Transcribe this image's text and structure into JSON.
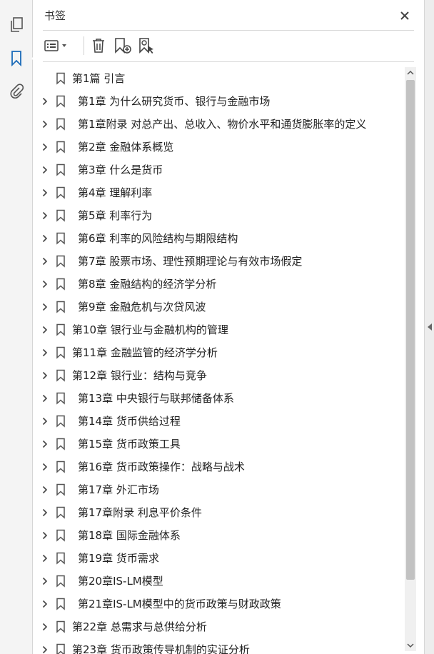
{
  "panel": {
    "title": "书签"
  },
  "icons": {
    "rail": [
      "pages-icon",
      "bookmark-icon",
      "attachment-icon"
    ],
    "toolbar": [
      "options-list-icon",
      "delete-icon",
      "new-bookmark-icon",
      "bookmark-search-icon"
    ]
  },
  "accent_color": "#1a6ab8",
  "bookmarks": [
    {
      "label": "第1篇  引言",
      "expandable": false,
      "indent": false
    },
    {
      "label": "第1章  为什么研究货币、银行与金融市场",
      "expandable": true,
      "indent": true
    },
    {
      "label": "第1章附录  对总产出、总收入、物价水平和通货膨胀率的定义",
      "expandable": true,
      "indent": true
    },
    {
      "label": "第2章  金融体系概览",
      "expandable": true,
      "indent": true
    },
    {
      "label": "第3章  什么是货币",
      "expandable": true,
      "indent": true
    },
    {
      "label": "第4章  理解利率",
      "expandable": true,
      "indent": true
    },
    {
      "label": "第5章  利率行为",
      "expandable": true,
      "indent": true
    },
    {
      "label": "第6章  利率的风险结构与期限结构",
      "expandable": true,
      "indent": true
    },
    {
      "label": "第7章  股票市场、理性预期理论与有效市场假定",
      "expandable": true,
      "indent": true
    },
    {
      "label": "第8章  金融结构的经济学分析",
      "expandable": true,
      "indent": true
    },
    {
      "label": "第9章  金融危机与次贷风波",
      "expandable": true,
      "indent": true
    },
    {
      "label": "第10章  银行业与金融机构的管理",
      "expandable": true,
      "indent": false
    },
    {
      "label": "第11章  金融监管的经济学分析",
      "expandable": true,
      "indent": false
    },
    {
      "label": "第12章  银行业：结构与竞争",
      "expandable": true,
      "indent": false
    },
    {
      "label": "第13章  中央银行与联邦储备体系",
      "expandable": true,
      "indent": true
    },
    {
      "label": "第14章  货币供给过程",
      "expandable": true,
      "indent": true
    },
    {
      "label": "第15章  货币政策工具",
      "expandable": true,
      "indent": true
    },
    {
      "label": "第16章  货币政策操作：战略与战术",
      "expandable": true,
      "indent": true
    },
    {
      "label": "第17章  外汇市场",
      "expandable": true,
      "indent": true
    },
    {
      "label": "第17章附录  利息平价条件",
      "expandable": true,
      "indent": true
    },
    {
      "label": "第18章  国际金融体系",
      "expandable": true,
      "indent": true
    },
    {
      "label": "第19章  货币需求",
      "expandable": true,
      "indent": true
    },
    {
      "label": "第20章IS-LM模型",
      "expandable": true,
      "indent": true
    },
    {
      "label": "第21章IS-LM模型中的货币政策与财政政策",
      "expandable": true,
      "indent": true
    },
    {
      "label": "第22章  总需求与总供给分析",
      "expandable": true,
      "indent": false
    },
    {
      "label": "第23章  货币政策传导机制的实证分析",
      "expandable": true,
      "indent": false
    }
  ]
}
